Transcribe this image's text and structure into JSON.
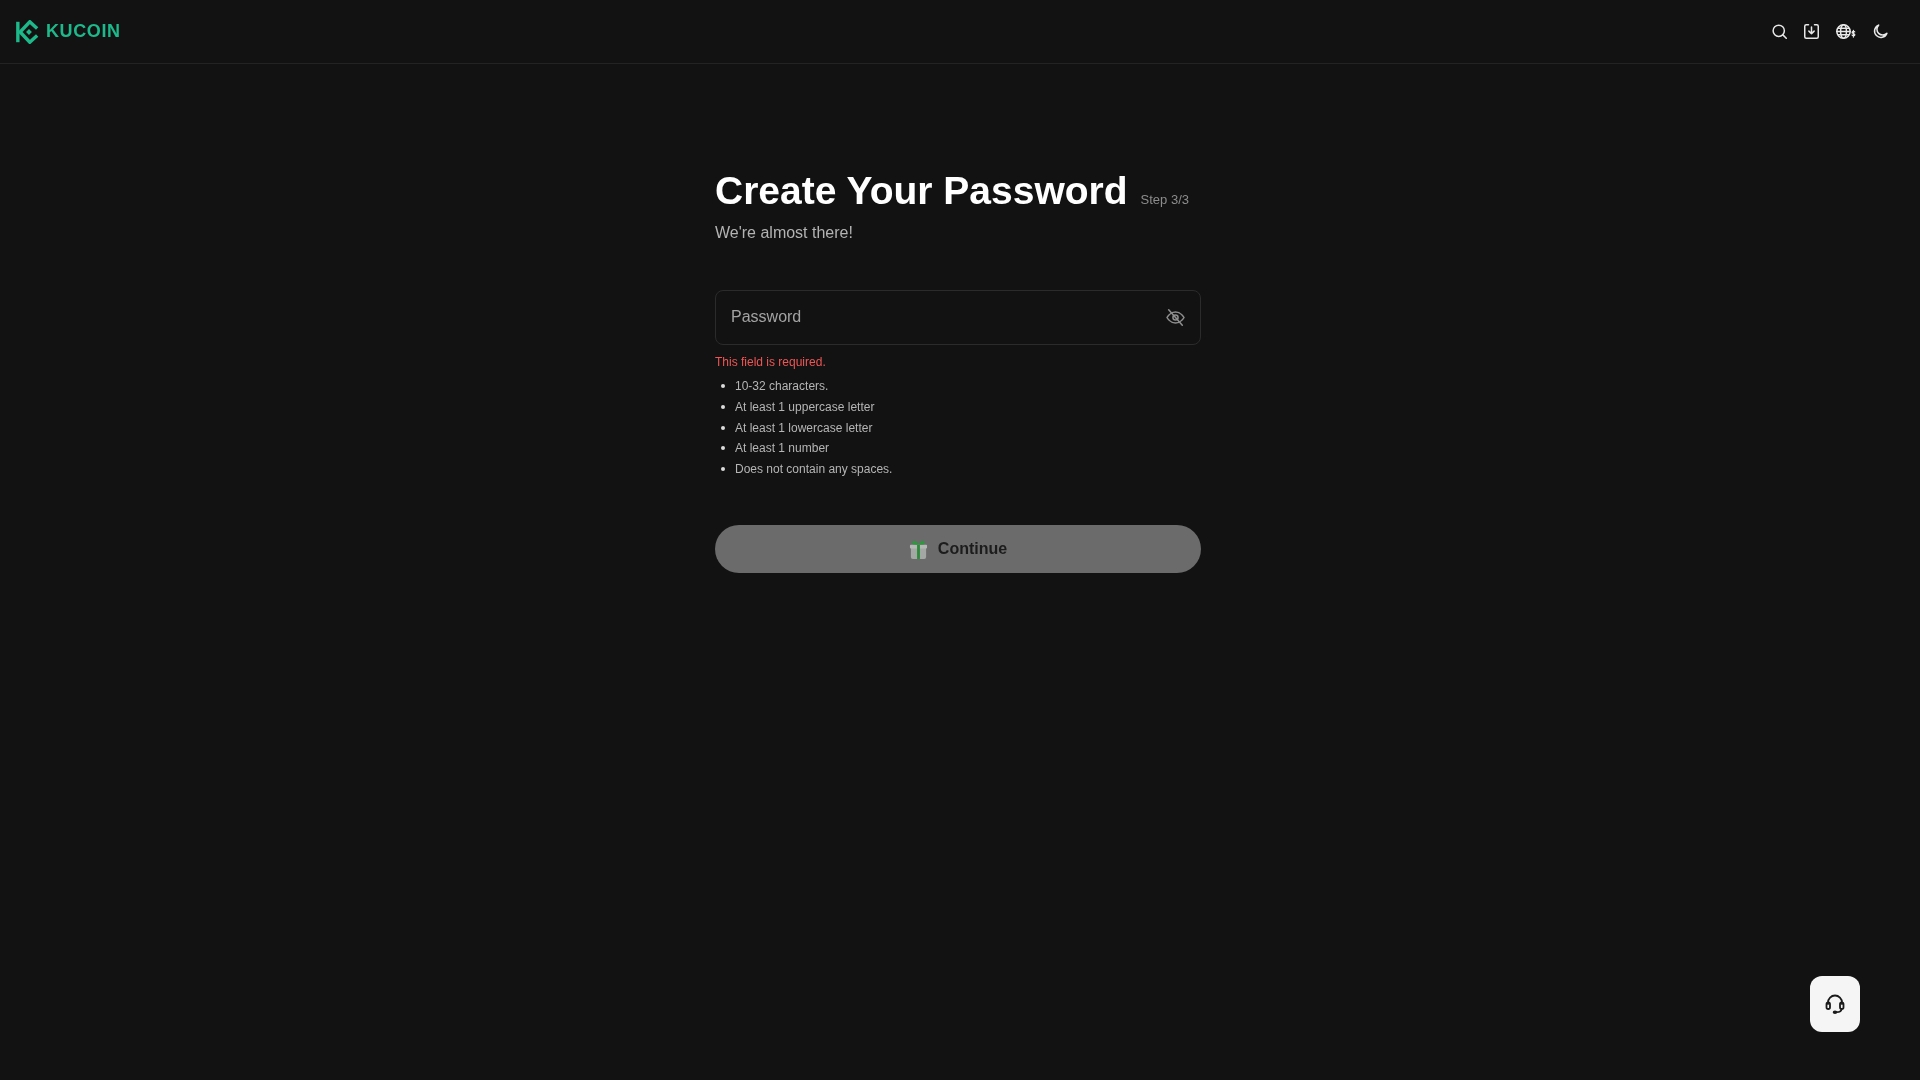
{
  "header": {
    "logo_text": "KUCOIN"
  },
  "page": {
    "title": "Create Your Password",
    "step": "Step 3/3",
    "subtitle": "We're almost there!"
  },
  "password_field": {
    "placeholder": "Password",
    "show_password": false
  },
  "error_message": "This field is required.",
  "requirements": [
    "10-32 characters.",
    "At least 1 uppercase letter",
    "At least 1 lowercase letter",
    "At least 1 number",
    "Does not contain any spaces."
  ],
  "continue_button": {
    "label": "Continue",
    "disabled": true
  }
}
